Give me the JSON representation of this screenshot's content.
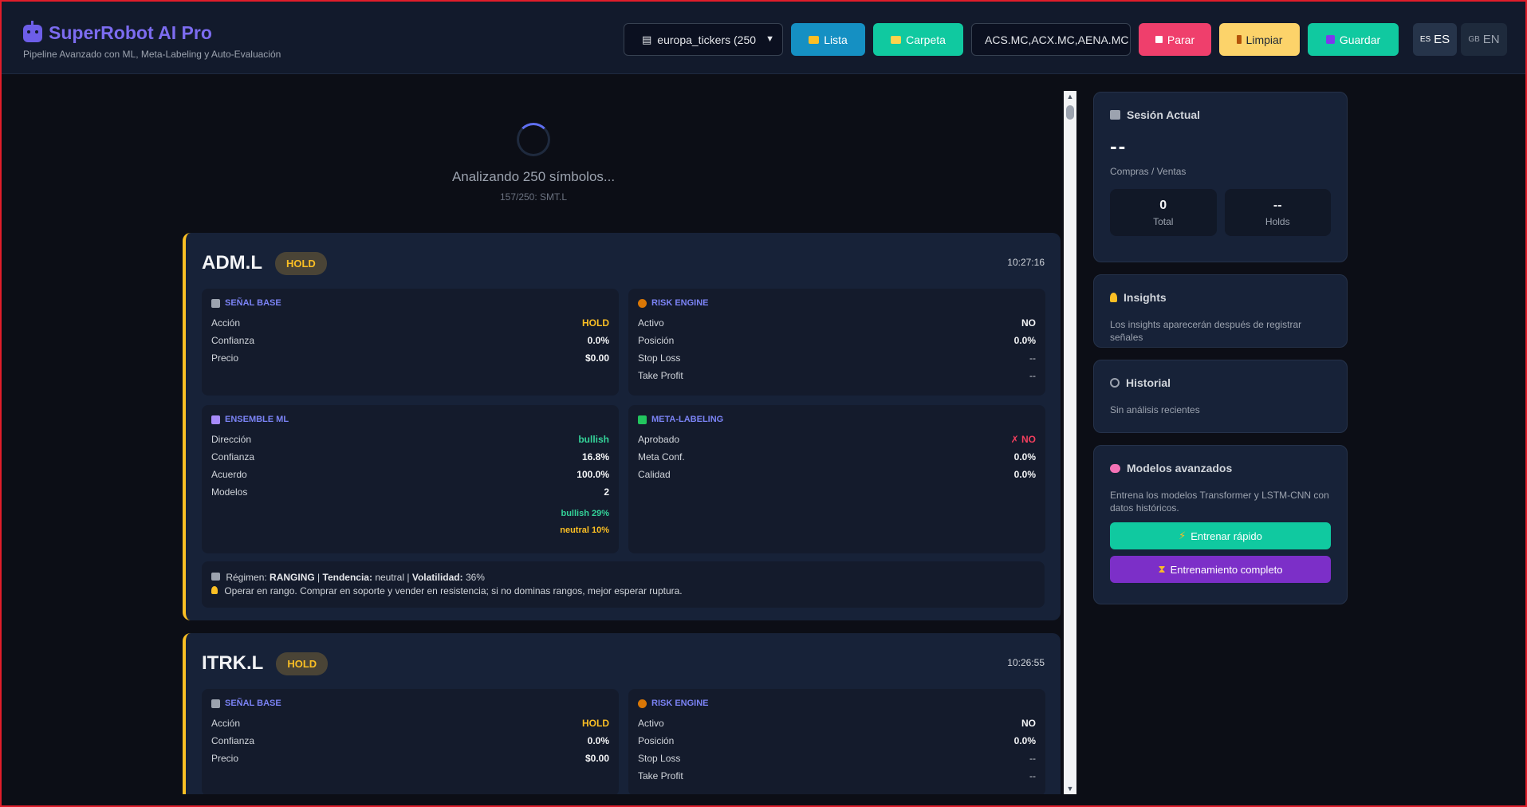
{
  "app": {
    "title": "SuperRobot AI Pro",
    "subtitle": "Pipeline Avanzado con ML, Meta-Labeling y Auto-Evaluación"
  },
  "toolbar": {
    "ticker_list_selected": "europa_tickers (250",
    "lista_label": "Lista",
    "carpeta_label": "Carpeta",
    "symbols_value": "ACS.MC,ACX.MC,AENA.MC",
    "parar_label": "Parar",
    "limpiar_label": "Limpiar",
    "guardar_label": "Guardar",
    "lang_es": "ES",
    "lang_es_flag": "ES",
    "lang_en": "EN",
    "lang_en_flag": "GB"
  },
  "loading": {
    "text": "Analizando 250 símbolos...",
    "progress": "157/250: SMT.L"
  },
  "labels": {
    "senal_base": "SEÑAL BASE",
    "risk_engine": "RISK ENGINE",
    "ensemble_ml": "ENSEMBLE ML",
    "meta_labeling": "META-LABELING",
    "accion": "Acción",
    "confianza": "Confianza",
    "precio": "Precio",
    "activo": "Activo",
    "posicion": "Posición",
    "stop_loss": "Stop Loss",
    "take_profit": "Take Profit",
    "direccion": "Dirección",
    "acuerdo": "Acuerdo",
    "modelos": "Modelos",
    "aprobado": "Aprobado",
    "meta_conf": "Meta Conf.",
    "calidad": "Calidad",
    "regimen": "Régimen:",
    "tendencia": "Tendencia:",
    "volatilidad": "Volatilidad:"
  },
  "cards": [
    {
      "ticker": "ADM.L",
      "badge": "HOLD",
      "time": "10:27:16",
      "base": {
        "accion": "HOLD",
        "confianza": "0.0%",
        "precio": "$0.00"
      },
      "risk": {
        "activo": "NO",
        "posicion": "0.0%",
        "stop_loss": "--",
        "take_profit": "--"
      },
      "ensemble": {
        "direccion": "bullish",
        "confianza": "16.8%",
        "acuerdo": "100.0%",
        "modelos": "2",
        "dist_bullish": "bullish 29%",
        "dist_neutral": "neutral 10%"
      },
      "meta": {
        "aprobado": "✗ NO",
        "meta_conf": "0.0%",
        "calidad": "0.0%"
      },
      "regime": {
        "regimen": "RANGING",
        "tendencia": "neutral",
        "volatilidad": "36%",
        "tip": "Operar en rango. Comprar en soporte y vender en resistencia; si no dominas rangos, mejor esperar ruptura."
      }
    },
    {
      "ticker": "ITRK.L",
      "badge": "HOLD",
      "time": "10:26:55",
      "base": {
        "accion": "HOLD",
        "confianza": "0.0%",
        "precio": "$0.00"
      },
      "risk": {
        "activo": "NO",
        "posicion": "0.0%",
        "stop_loss": "--",
        "take_profit": "--"
      }
    }
  ],
  "sidebar": {
    "session": {
      "title": "Sesión Actual",
      "big_value": "--",
      "caption": "Compras / Ventas",
      "total_value": "0",
      "total_label": "Total",
      "holds_value": "--",
      "holds_label": "Holds"
    },
    "insights": {
      "title": "Insights",
      "text": "Los insights aparecerán después de registrar señales"
    },
    "historial": {
      "title": "Historial",
      "text": "Sin análisis recientes"
    },
    "models": {
      "title": "Modelos avanzados",
      "text": "Entrena los modelos Transformer y LSTM-CNN con datos históricos.",
      "quick_label": "Entrenar rápido",
      "full_label": "Entrenamiento completo"
    }
  },
  "colors": {
    "accent": "#7c6cf0",
    "hold": "#fbbf24",
    "bullish": "#34d399",
    "danger": "#f43f5e"
  }
}
